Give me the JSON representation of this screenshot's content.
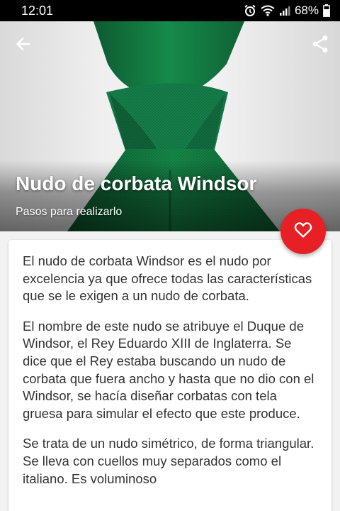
{
  "status_bar": {
    "time": "12:01",
    "battery": "68%",
    "icons": [
      "alarm-icon",
      "wifi-icon",
      "signal-icon",
      "battery-icon"
    ]
  },
  "hero": {
    "title": "Nudo de corbata Windsor",
    "subtitle": "Pasos para realizarlo",
    "tie_color": "#136b3d"
  },
  "toolbar": {
    "back_icon": "arrow-left-icon",
    "share_icon": "share-icon"
  },
  "fab": {
    "icon": "heart-outline-icon",
    "color": "#e62025"
  },
  "content": {
    "paragraphs": [
      "El nudo de corbata Windsor es el nudo por excelencia ya que ofrece todas las características que se le exigen a un nudo de corbata.",
      "El nombre de este nudo se atribuye el Duque de Windsor, el Rey Eduardo XIII de Inglaterra. Se dice que el Rey estaba buscando un nudo de corbata que fuera ancho y hasta que no dio con el Windsor, se hacía diseñar corbatas con tela gruesa para simular el efecto que este produce.",
      "Se trata de un nudo simétrico, de forma triangular. Se lleva con cuellos muy separados como el italiano. Es voluminoso"
    ]
  }
}
